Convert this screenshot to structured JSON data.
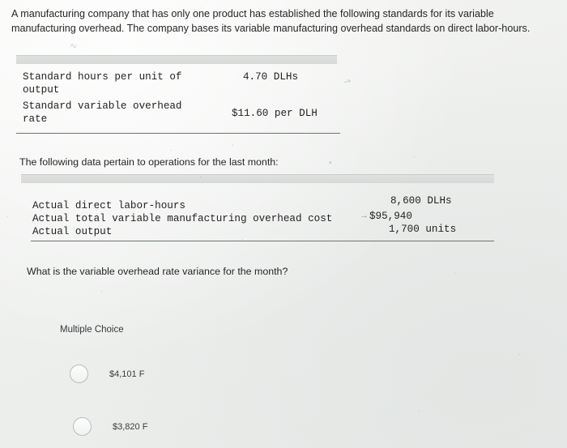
{
  "document": {
    "intro": "A manufacturing company that has only one product has established the following standards for its variable manufacturing overhead. The company bases its variable manufacturing overhead standards on direct labor-hours.",
    "standards_table": {
      "rows": [
        {
          "label_line1": "Standard hours per unit of",
          "label_line2": "output",
          "value": "4.70 DLHs"
        },
        {
          "label_line1": "Standard variable overhead",
          "label_line2": "rate",
          "value": "$11.60 per DLH"
        }
      ]
    },
    "pertain_text": "The following data pertain to operations for the last month:",
    "actuals_table": {
      "rows": [
        {
          "label": "Actual direct labor-hours",
          "value": "8,600 DLHs"
        },
        {
          "label": "Actual total variable manufacturing overhead cost",
          "value": "$95,940"
        },
        {
          "label": "Actual output",
          "value": "1,700 units"
        }
      ]
    },
    "question": "What is the variable overhead rate variance for the month?",
    "multiple_choice_label": "Multiple Choice",
    "choices": [
      {
        "text": "$4,101 F"
      },
      {
        "text": "$3,820 F"
      }
    ],
    "marks": {
      "m1": "∿",
      "m2": "↗",
      "m3": "˙",
      "m4": ".",
      "m5": "'",
      "m6": "•",
      "m7": ".",
      "m8": "·",
      "m9": ".",
      "m10": ".",
      "m11": "→",
      "m12": ".",
      "m13": ".",
      "m14": ".",
      "m15": "."
    },
    "colors": {
      "page_background": "#f2f2f0",
      "text": "#262626",
      "rule": "#6e7472",
      "bar": "#dfe1df"
    }
  }
}
